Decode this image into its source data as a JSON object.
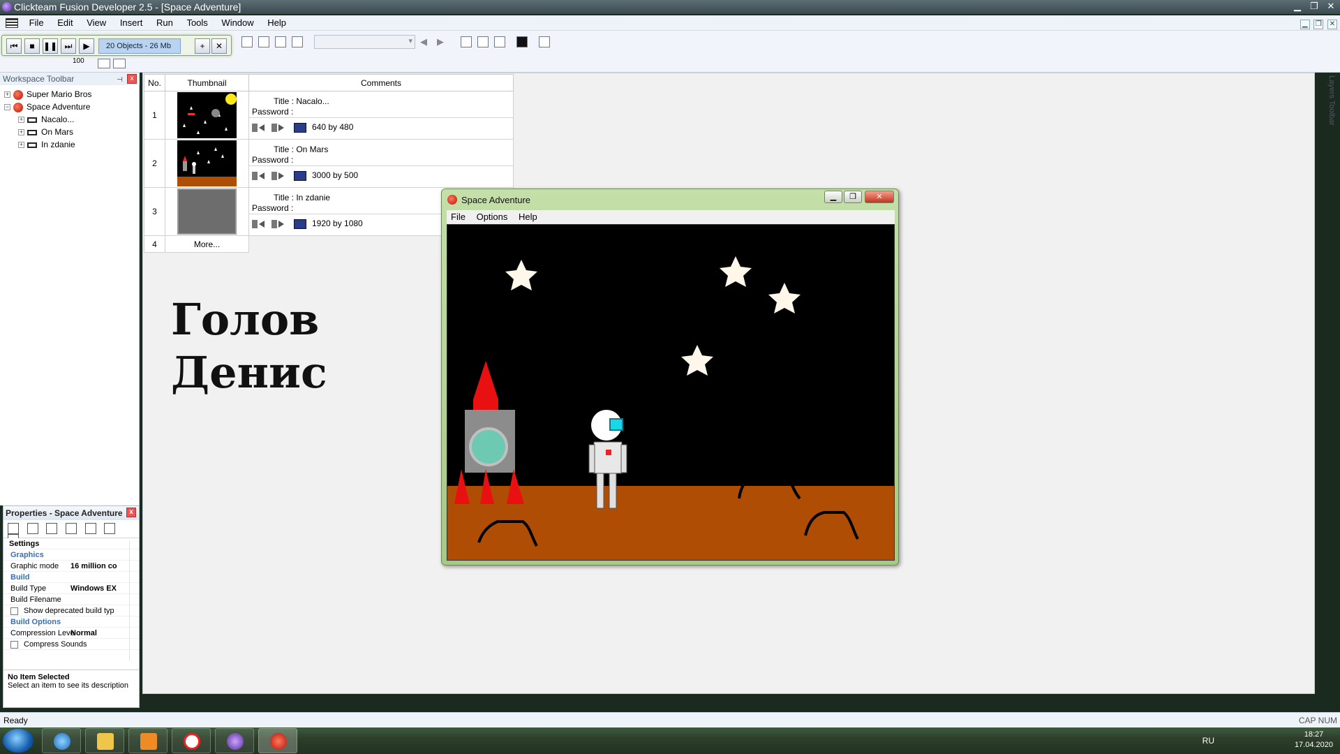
{
  "window": {
    "title": "Clickteam Fusion Developer 2.5 - [Space Adventure]",
    "controls": {
      "minimize": "▁",
      "maximize": "❐",
      "close": "✕"
    }
  },
  "menubar": {
    "items": [
      "File",
      "Edit",
      "View",
      "Insert",
      "Run",
      "Tools",
      "Window",
      "Help"
    ]
  },
  "runbar": {
    "object_count": "20 Objects - 26 Mb",
    "buttons": {
      "rewind": "⏮",
      "stop": "■",
      "pause": "❚❚",
      "step": "⏭",
      "play": "▶",
      "add": "+",
      "close": "✕"
    }
  },
  "zoom": {
    "value": "100"
  },
  "workspace": {
    "title": "Workspace Toolbar",
    "pin": "⊣",
    "close": "x",
    "tree": [
      {
        "label": "Super Mario Bros",
        "kind": "app",
        "expander": "+"
      },
      {
        "label": "Space Adventure",
        "kind": "app",
        "expander": "−"
      },
      {
        "label": "Nacalo...",
        "kind": "frame",
        "expander": "+"
      },
      {
        "label": "On Mars",
        "kind": "frame",
        "expander": "+"
      },
      {
        "label": "In zdanie",
        "kind": "frame",
        "expander": "+"
      }
    ]
  },
  "properties": {
    "title": "Properties - Space Adventure",
    "close": "x",
    "settings_header": "Settings",
    "section_graphics": "Graphics",
    "graphic_mode_label": "Graphic mode",
    "graphic_mode_value": "16 million co",
    "section_build": "Build",
    "build_type_label": "Build Type",
    "build_type_value": "Windows EX",
    "build_filename_label": "Build Filename",
    "show_deprecated_label": "Show deprecated build typ",
    "section_build_options": "Build Options",
    "compression_label": "Compression Leve",
    "compression_value": "Normal",
    "compress_sounds_label": "Compress Sounds",
    "desc_title": "No Item Selected",
    "desc_text": "Select an item to see its description"
  },
  "storyboard": {
    "headers": {
      "no": "No.",
      "thumbnail": "Thumbnail",
      "comments": "Comments"
    },
    "title_label": "Title :",
    "password_label": "Password :",
    "frames": [
      {
        "no": "1",
        "title": "Nacalo...",
        "size": "640  by  480"
      },
      {
        "no": "2",
        "title": "On Mars",
        "size": "3000 by  500"
      },
      {
        "no": "3",
        "title": "In zdanie",
        "size": "1920 by 1080"
      }
    ],
    "more_no": "4",
    "more_label": "More..."
  },
  "canvas_text": {
    "line1": "Голов",
    "line2": "Денис"
  },
  "game_window": {
    "title": "Space Adventure",
    "menu": [
      "File",
      "Options",
      "Help"
    ],
    "controls": {
      "minimize": "▁",
      "maximize": "❐",
      "close": "✕"
    },
    "colors": {
      "sky": "#000000",
      "ground": "#b04d04",
      "rocket": "#e81010",
      "star": "#fff8ea"
    }
  },
  "layers_tab": "Layers Toolbar",
  "statusbar": {
    "text": "Ready",
    "caps": "CAP  NUM"
  },
  "taskbar": {
    "language": "RU",
    "time": "18:27",
    "date": "17.04.2020"
  }
}
